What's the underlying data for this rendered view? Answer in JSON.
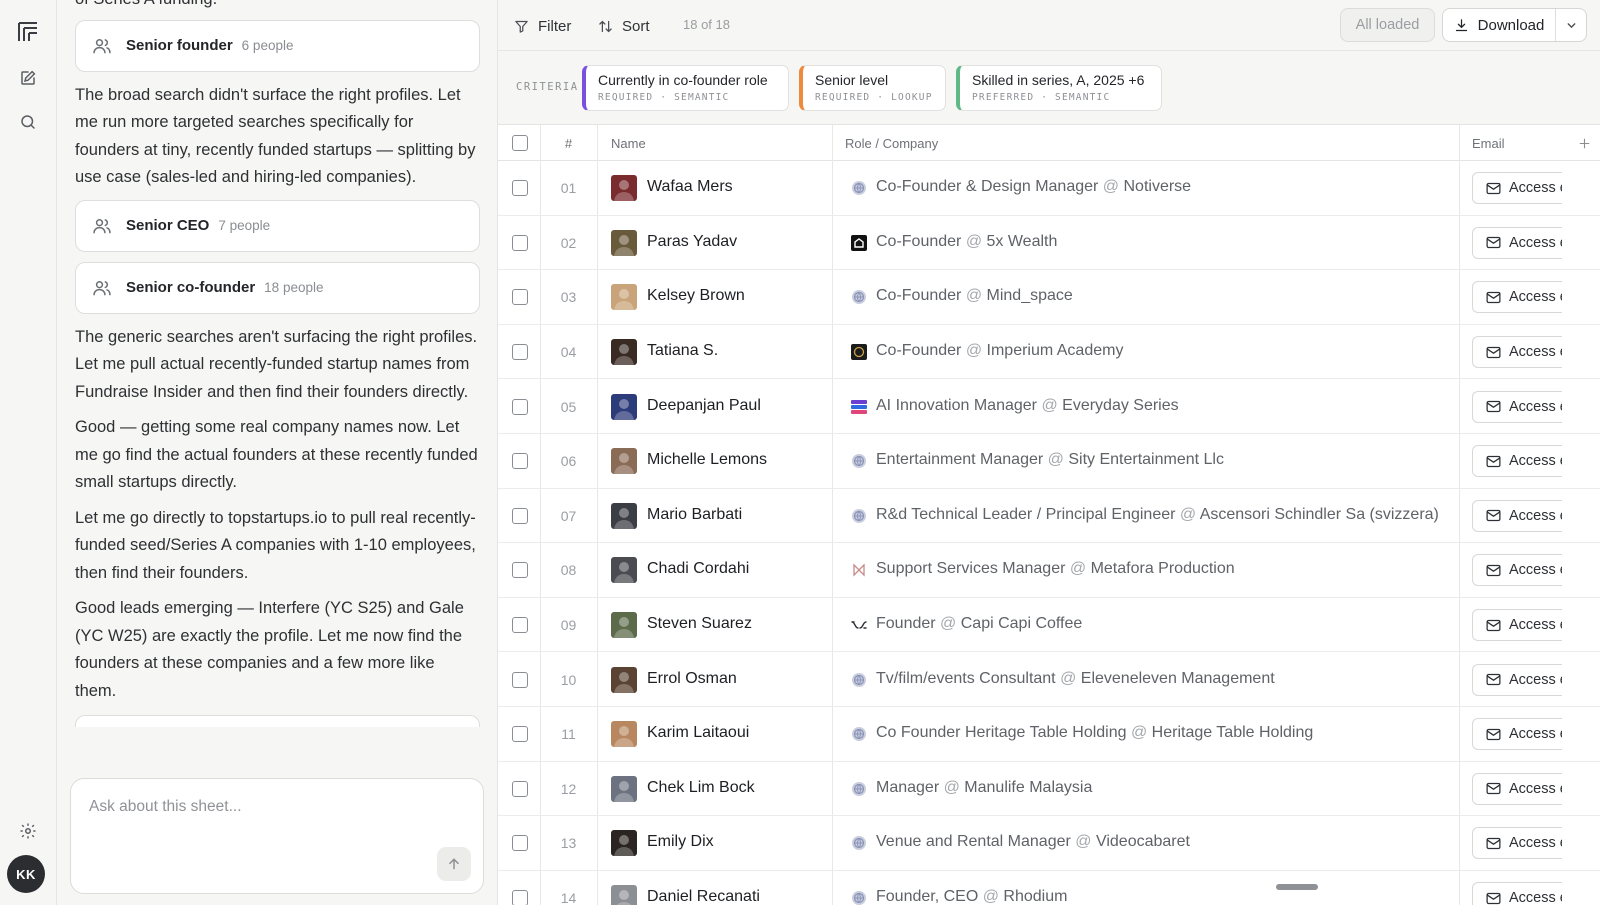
{
  "rail": {
    "avatar_initials": "KK"
  },
  "chat": {
    "top_partial": "of Series A funding.",
    "blocks": [
      {
        "type": "tool",
        "name": "Senior founder",
        "count": "6 people"
      },
      {
        "type": "text",
        "text": "The broad search didn't surface the right profiles. Let me run more targeted searches specifically for founders at tiny, recently funded startups — splitting by use case (sales-led and hiring-led companies)."
      },
      {
        "type": "tool",
        "name": "Senior CEO",
        "count": "7 people"
      },
      {
        "type": "tool",
        "name": "Senior co-founder",
        "count": "18 people"
      },
      {
        "type": "text",
        "text": "The generic searches aren't surfacing the right profiles. Let me pull actual recently-funded startup names from Fundraise Insider and then find their founders directly."
      },
      {
        "type": "text",
        "text": "Good — getting some real company names now. Let me go find the actual founders at these recently funded small startups directly."
      },
      {
        "type": "text",
        "text": "Let me go directly to topstartups.io to pull real recently-funded seed/Series A companies with 1-10 employees, then find their founders."
      },
      {
        "type": "text",
        "text": "Good leads emerging — Interfere (YC S25) and Gale (YC W25) are exactly the profile. Let me now find the founders at these companies and a few more like them."
      }
    ],
    "composer_placeholder": "Ask about this sheet..."
  },
  "toolbar": {
    "filter_label": "Filter",
    "sort_label": "Sort",
    "count_label": "18 of 18",
    "all_loaded_label": "All loaded",
    "download_label": "Download"
  },
  "criteria": {
    "label": "CRITERIA",
    "items": [
      {
        "name": "Currently in co-founder role",
        "meta": "REQUIRED · SEMANTIC",
        "color": "#7b4fe0"
      },
      {
        "name": "Senior level",
        "meta": "REQUIRED · LOOKUP",
        "color": "#ee8a3c"
      },
      {
        "name": "Skilled in series, A, 2025 +6",
        "meta": "PREFERRED · SEMANTIC",
        "color": "#5fb985"
      }
    ]
  },
  "table": {
    "columns": {
      "num": "#",
      "name": "Name",
      "role": "Role / Company",
      "email": "Email"
    },
    "email_button_label": "Access email",
    "rows": [
      {
        "num": "01",
        "name": "Wafaa Mers",
        "role": "Co-Founder & Design Manager",
        "company": "Notiverse",
        "company_icon": "globe-icon",
        "avatar_color": "#7a2b2e"
      },
      {
        "num": "02",
        "name": "Paras Yadav",
        "role": "Co-Founder",
        "company": "5x Wealth",
        "company_icon": "home-logo-icon",
        "avatar_color": "#6a5a3c"
      },
      {
        "num": "03",
        "name": "Kelsey Brown",
        "role": "Co-Founder",
        "company": "Mind_space",
        "company_icon": "globe-icon",
        "avatar_color": "#c9a47a"
      },
      {
        "num": "04",
        "name": "Tatiana S.",
        "role": "Co-Founder",
        "company": "Imperium Academy",
        "company_icon": "crest-logo-icon",
        "avatar_color": "#3a2a24"
      },
      {
        "num": "05",
        "name": "Deepanjan Paul",
        "role": "AI Innovation Manager",
        "company": "Everyday Series",
        "company_icon": "stack-logo-icon",
        "avatar_color": "#2c3b7a"
      },
      {
        "num": "06",
        "name": "Michelle Lemons",
        "role": "Entertainment Manager",
        "company": "Sity Entertainment Llc",
        "company_icon": "globe-icon",
        "avatar_color": "#8a6b55"
      },
      {
        "num": "07",
        "name": "Mario Barbati",
        "role": "R&d Technical Leader / Principal Engineer",
        "company": "Ascensori Schindler Sa (svizzera)",
        "company_icon": "globe-icon",
        "avatar_color": "#3b3e44"
      },
      {
        "num": "08",
        "name": "Chadi Cordahi",
        "role": "Support Services Manager",
        "company": "Metafora Production",
        "company_icon": "bowtie-logo-icon",
        "avatar_color": "#4a4c52"
      },
      {
        "num": "09",
        "name": "Steven Suarez",
        "role": "Founder",
        "company": "Capi Capi Coffee",
        "company_icon": "wave-logo-icon",
        "avatar_color": "#5c6b4a"
      },
      {
        "num": "10",
        "name": "Errol Osman",
        "role": "Tv/film/events Consultant",
        "company": "Eleveneleven Management",
        "company_icon": "globe-icon",
        "avatar_color": "#5a4332"
      },
      {
        "num": "11",
        "name": "Karim Laitaoui",
        "role": "Co Founder Heritage Table Holding",
        "company": "Heritage Table Holding",
        "company_icon": "globe-icon",
        "avatar_color": "#b8875f"
      },
      {
        "num": "12",
        "name": "Chek Lim Bock",
        "role": "Manager",
        "company": "Manulife Malaysia",
        "company_icon": "globe-icon",
        "avatar_color": "#6d7280"
      },
      {
        "num": "13",
        "name": "Emily Dix",
        "role": "Venue and Rental Manager",
        "company": "Videocabaret",
        "company_icon": "globe-icon",
        "avatar_color": "#2a2522"
      },
      {
        "num": "14",
        "name": "Daniel Recanati",
        "role": "Founder, CEO",
        "company": "Rhodium",
        "company_icon": "globe-icon",
        "avatar_color": "#8c8f94"
      }
    ]
  }
}
